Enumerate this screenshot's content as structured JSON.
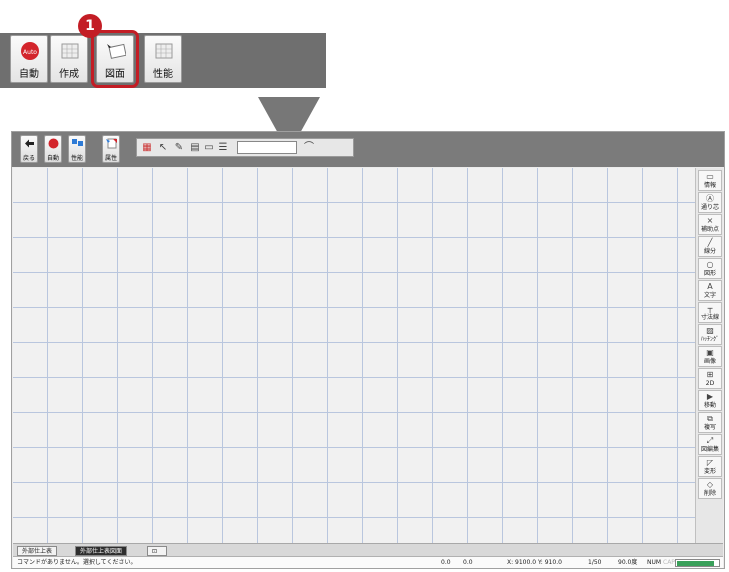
{
  "callout": {
    "badge": "1",
    "buttons": [
      {
        "label": "自動"
      },
      {
        "label": "作成"
      },
      {
        "label": "図面"
      },
      {
        "label": "性能"
      }
    ]
  },
  "toolbar": {
    "buttons": [
      {
        "label": "戻る"
      },
      {
        "label": "自動"
      },
      {
        "label": "性能"
      },
      {
        "label": "属性"
      }
    ],
    "zoom_value": ""
  },
  "palette": {
    "items": [
      {
        "label": "情報",
        "icon": "ruler-icon"
      },
      {
        "label": "通り芯",
        "icon": "grid-axis-icon"
      },
      {
        "label": "補助点",
        "icon": "cross-point-icon"
      },
      {
        "label": "線分",
        "icon": "line-icon"
      },
      {
        "label": "図形",
        "icon": "shape-icon"
      },
      {
        "label": "文字",
        "icon": "text-icon"
      },
      {
        "label": "寸法線",
        "icon": "dimension-icon"
      },
      {
        "label": "ﾊｯﾁﾝｸﾞ",
        "icon": "hatching-icon"
      },
      {
        "label": "画像",
        "icon": "image-icon"
      },
      {
        "label": "2D",
        "icon": "2d-icon"
      },
      {
        "label": "移動",
        "icon": "move-icon"
      },
      {
        "label": "複写",
        "icon": "copy-icon"
      },
      {
        "label": "図編集",
        "icon": "edit-icon"
      },
      {
        "label": "変形",
        "icon": "transform-icon"
      },
      {
        "label": "削除",
        "icon": "eraser-icon"
      }
    ]
  },
  "tabs": [
    {
      "label": "外部仕上表",
      "active": false
    },
    {
      "label": "外部仕上表図面",
      "active": true
    }
  ],
  "status": {
    "message": "コマンドがありません。選択してください。",
    "coord_a": "0.0",
    "coord_b": "0.0",
    "xy": "X: 9100.0 Y: 910.0",
    "scale": "1/50",
    "angle": "90.0度",
    "num": "NUM",
    "caps": "CAPS",
    "progress": 0.9
  },
  "colors": {
    "highlight": "#c31d25",
    "toolbar_bg": "#7b7b7b",
    "grid": "#b9c6de"
  }
}
